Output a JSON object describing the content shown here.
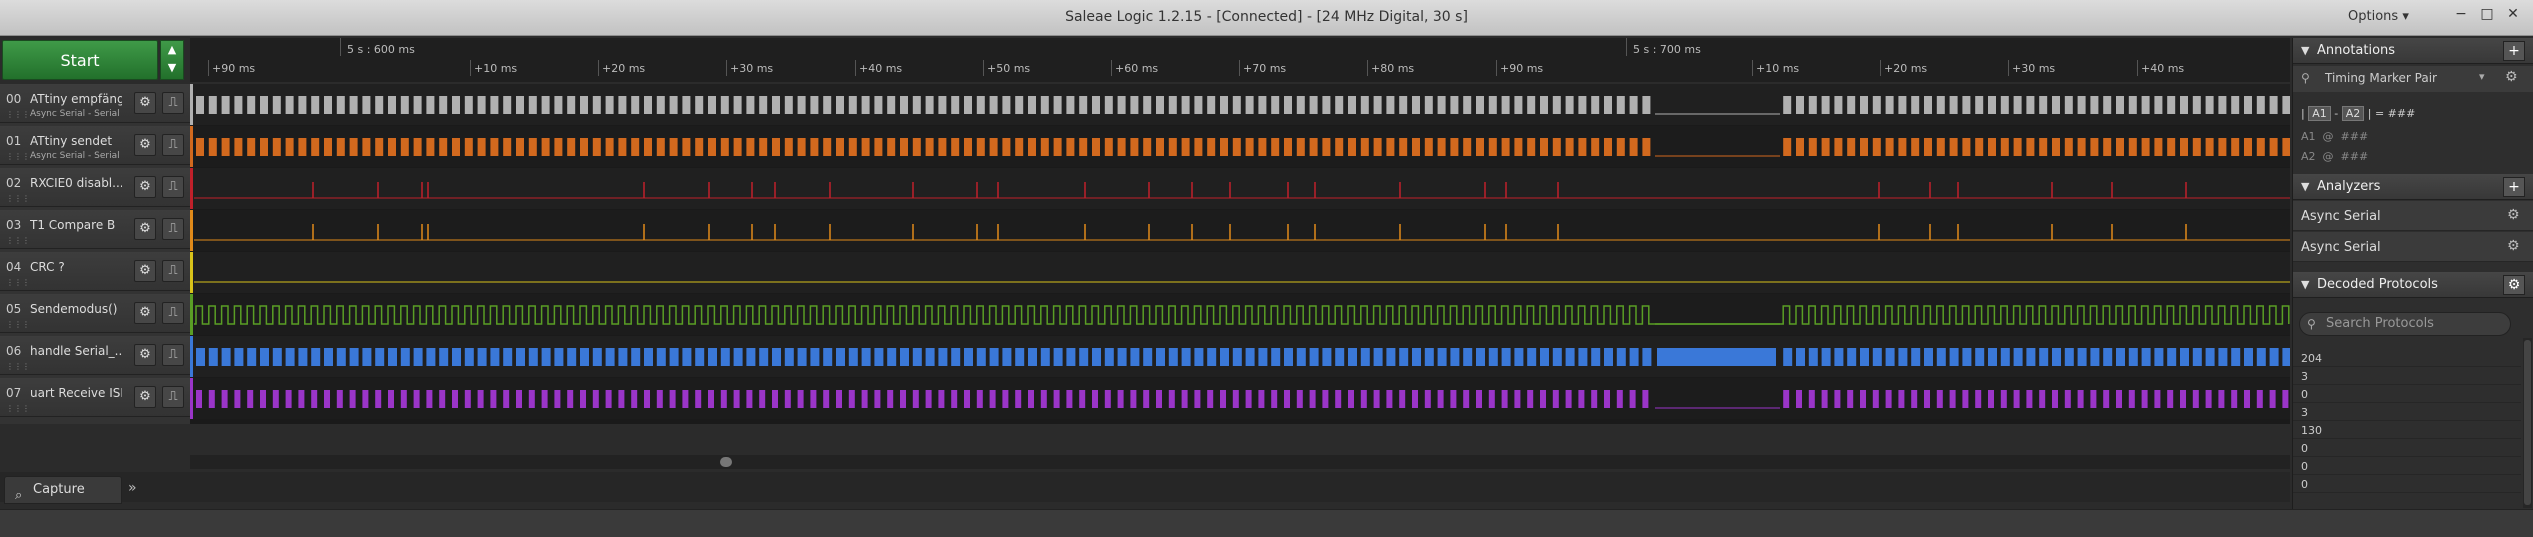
{
  "window": {
    "title": "Saleae Logic 1.2.15 - [Connected] - [24 MHz Digital, 30 s]",
    "options_label": "Options",
    "controls": [
      "−",
      "□",
      "✕"
    ]
  },
  "toolbar": {
    "start_label": "Start"
  },
  "timeline": {
    "group_labels": [
      "5 s : 600 ms",
      "5 s : 700 ms"
    ],
    "ticks": [
      "+90 ms",
      "+10 ms",
      "+20 ms",
      "+30 ms",
      "+40 ms",
      "+50 ms",
      "+60 ms",
      "+70 ms",
      "+80 ms",
      "+90 ms",
      "+10 ms",
      "+20 ms",
      "+30 ms",
      "+40 ms"
    ]
  },
  "channels": [
    {
      "index": "00",
      "name": "ATtiny empfängt",
      "analyzer": "Async Serial - Serial",
      "color": "#b0b0b0",
      "signal": "serial"
    },
    {
      "index": "01",
      "name": "ATtiny sendet",
      "analyzer": "Async Serial - Serial",
      "color": "#d2691e",
      "signal": "serial"
    },
    {
      "index": "02",
      "name": "RXCIE0 disabl...",
      "analyzer": "",
      "color": "#c0202a",
      "signal": "spikes"
    },
    {
      "index": "03",
      "name": "T1 Compare B",
      "analyzer": "",
      "color": "#e08a1a",
      "signal": "spikes"
    },
    {
      "index": "04",
      "name": "CRC ?",
      "analyzer": "",
      "color": "#d8c21a",
      "signal": "flat"
    },
    {
      "index": "05",
      "name": "Sendemodus()",
      "analyzer": "",
      "color": "#5a9e25",
      "signal": "square"
    },
    {
      "index": "06",
      "name": "handle Serial_...",
      "analyzer": "",
      "color": "#3a78d8",
      "signal": "blocks"
    },
    {
      "index": "07",
      "name": "uart Receive ISR",
      "analyzer": "",
      "color": "#9a35c8",
      "signal": "isr"
    }
  ],
  "bottom": {
    "capture_tab": "Capture"
  },
  "panel": {
    "annotations": {
      "title": "Annotations",
      "marker": "Timing Marker Pair",
      "formula_a1": "A1",
      "formula_a2": "A2",
      "formula_sep": "-",
      "formula_result": "= ###",
      "rows": [
        {
          "label": "A1",
          "value": "###"
        },
        {
          "label": "A2",
          "value": "###"
        }
      ]
    },
    "analyzers": {
      "title": "Analyzers",
      "items": [
        "Async Serial",
        "Async Serial"
      ]
    },
    "decoded": {
      "title": "Decoded Protocols",
      "search_placeholder": "Search Protocols",
      "values": [
        "204",
        "3",
        "0",
        "3",
        "130",
        "0",
        "0",
        "0"
      ]
    }
  }
}
